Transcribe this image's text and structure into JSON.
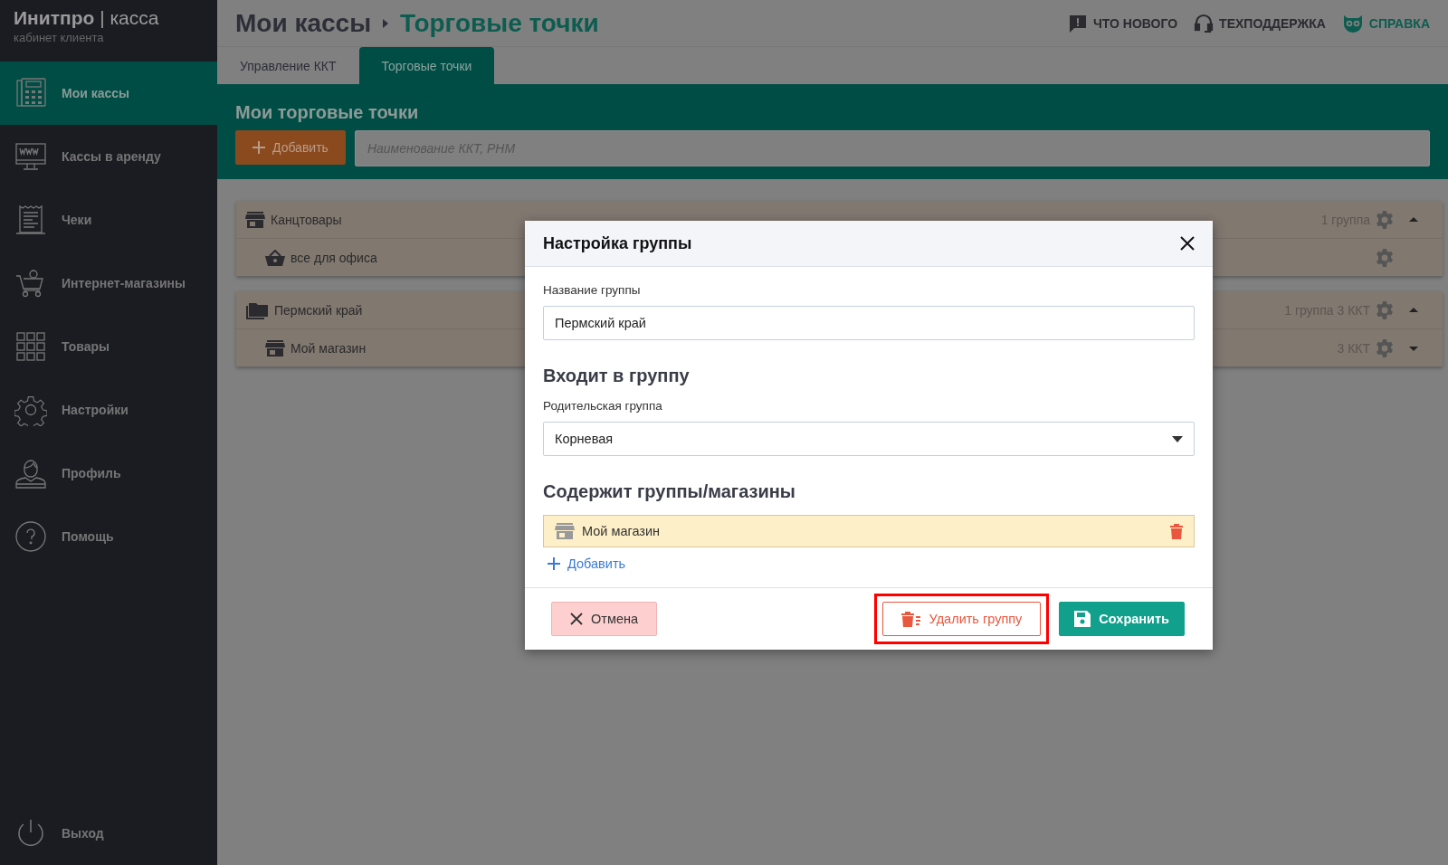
{
  "brand": {
    "title": "**Инитпро** | касса",
    "subtitle": "кабинет клиента"
  },
  "sidebar": {
    "items": [
      {
        "label": "Мои кассы",
        "kind": "register",
        "selected": true
      },
      {
        "label": "Кассы в аренду",
        "kind": "monitor",
        "selected": false
      },
      {
        "label": "Чеки",
        "kind": "receipt",
        "selected": false
      },
      {
        "label": "Интернет-магазины",
        "kind": "cart",
        "selected": false
      },
      {
        "label": "Товары",
        "kind": "grid",
        "selected": false
      },
      {
        "label": "Настройки",
        "kind": "gear",
        "selected": false
      },
      {
        "label": "Профиль",
        "kind": "person",
        "selected": false
      },
      {
        "label": "Помощь",
        "kind": "help",
        "selected": false
      }
    ],
    "logout": {
      "label": "Выход"
    }
  },
  "header": {
    "breadcrumb": [
      {
        "label": "Мои кассы"
      },
      {
        "label": "Торговые точки"
      }
    ],
    "links": [
      {
        "label": "ЧТО НОВОГО",
        "kind": "chat",
        "accent": false
      },
      {
        "label": "ТЕХПОДДЕРЖКА",
        "kind": "headset",
        "accent": false
      },
      {
        "label": "СПРАВКА",
        "kind": "owl",
        "accent": true
      }
    ]
  },
  "tabs": [
    {
      "label": "Управление ККТ",
      "selected": false
    },
    {
      "label": "Торговые точки",
      "selected": true
    }
  ],
  "toolbar": {
    "title": "Мои торговые точки",
    "add_button": "Добавить",
    "search": {
      "placeholder": "Наименование ККТ, РНМ"
    }
  },
  "groups": [
    {
      "name": "Канцтовары",
      "kind": "store",
      "summary": "1 группа",
      "expanded": true,
      "children": [
        {
          "name": "все для офиса",
          "kind": "basket"
        }
      ]
    },
    {
      "name": "Пермский край",
      "kind": "folder",
      "summary": "1 группа 3 ККТ",
      "expanded": true,
      "children": [
        {
          "name": "Мой магазин",
          "kind": "store",
          "summary": "3 ККТ",
          "expanded": false
        }
      ]
    }
  ],
  "dialog": {
    "title": "Настройка группы",
    "name_field": {
      "label": "Название группы",
      "value": "Пермский край"
    },
    "parent_heading": "Входит в группу",
    "parent_field": {
      "label": "Родительская группа",
      "value": "Корневая"
    },
    "contents_heading": "Содержит группы/магазины",
    "contents": [
      {
        "name": "Мой магазин"
      }
    ],
    "add_link": "Добавить",
    "buttons": [
      {
        "kind": "cancel",
        "label": "Отмена",
        "highlighted": false
      },
      {
        "kind": "delete",
        "label": "Удалить группу",
        "highlighted": true
      },
      {
        "kind": "save",
        "label": "Сохранить",
        "highlighted": false
      }
    ]
  }
}
